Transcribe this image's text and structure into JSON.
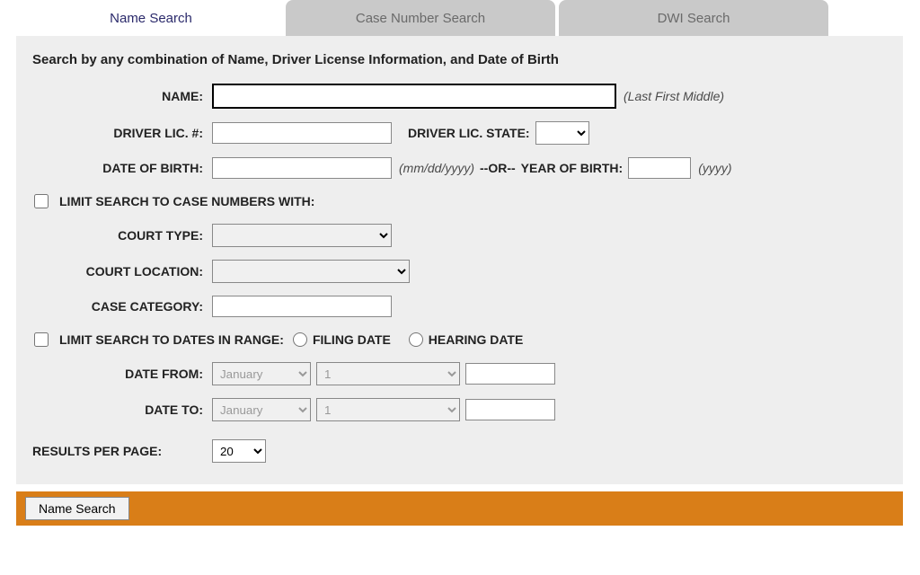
{
  "tabs": {
    "name": "Name Search",
    "case": "Case Number Search",
    "dwi": "DWI Search"
  },
  "heading": "Search by any combination of Name, Driver License Information, and Date of Birth",
  "labels": {
    "name": "NAME:",
    "name_hint": "(Last First Middle)",
    "dl_num": "DRIVER LIC. #:",
    "dl_state": "DRIVER LIC. STATE:",
    "dob": "DATE OF BIRTH:",
    "dob_hint": "(mm/dd/yyyy)",
    "or": "--OR--",
    "yob": "YEAR OF BIRTH:",
    "yob_hint": "(yyyy)",
    "limit_case": "LIMIT SEARCH TO CASE NUMBERS WITH:",
    "court_type": "COURT TYPE:",
    "court_loc": "COURT LOCATION:",
    "case_cat": "CASE CATEGORY:",
    "limit_dates": "LIMIT SEARCH TO DATES IN RANGE:",
    "filing_date": "FILING DATE",
    "hearing_date": "HEARING DATE",
    "date_from": "DATE FROM:",
    "date_to": "DATE TO:",
    "results_per_page": "RESULTS PER PAGE:"
  },
  "selects": {
    "month_from": "January",
    "day_from": "1",
    "month_to": "January",
    "day_to": "1",
    "results": "20"
  },
  "button": {
    "submit": "Name Search"
  }
}
